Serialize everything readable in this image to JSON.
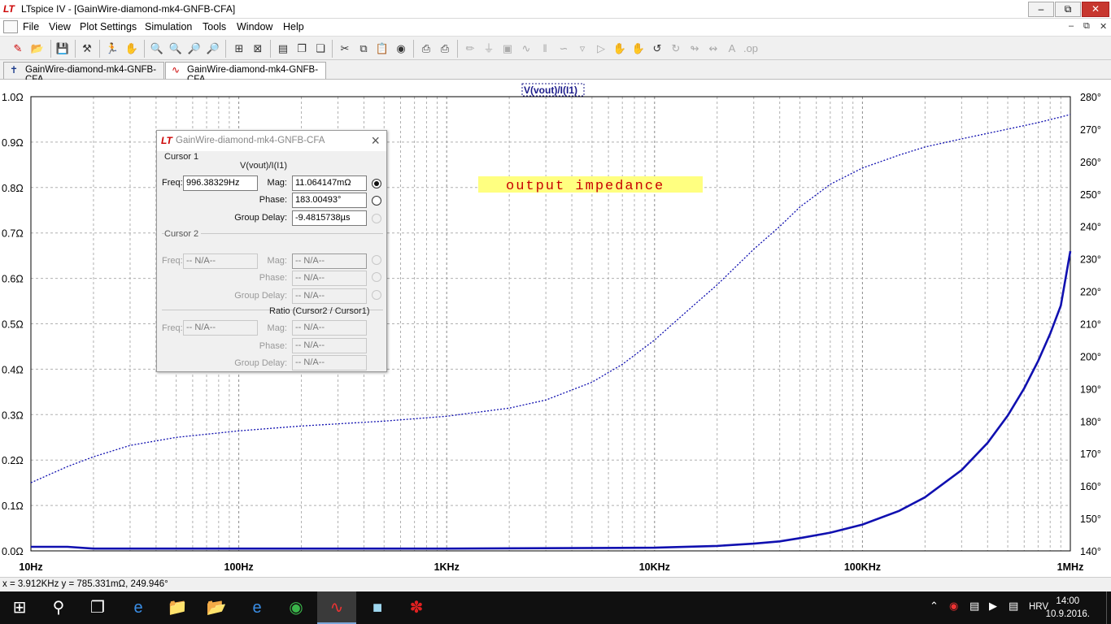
{
  "window": {
    "title": "LTspice IV - [GainWire-diamond-mk4-GNFB-CFA]"
  },
  "menu": {
    "items": [
      "File",
      "View",
      "Plot Settings",
      "Simulation",
      "Tools",
      "Window",
      "Help"
    ]
  },
  "tabs": [
    {
      "label": "GainWire-diamond-mk4-GNFB-CFA"
    },
    {
      "label": "GainWire-diamond-mk4-GNFB-CFA"
    }
  ],
  "plot": {
    "trace_label": "V(vout)/I(I1)",
    "annotation": "output impedance"
  },
  "chart_data": {
    "type": "line",
    "title": "V(vout)/I(I1)",
    "x_scale": "log",
    "xlim": [
      10,
      1000000
    ],
    "x_tick_labels": [
      {
        "value": 10,
        "label": "10Hz"
      },
      {
        "value": 100,
        "label": "100Hz"
      },
      {
        "value": 1000,
        "label": "1KHz"
      },
      {
        "value": 10000,
        "label": "10KHz"
      },
      {
        "value": 100000,
        "label": "100KHz"
      },
      {
        "value": 1000000,
        "label": "1MHz"
      }
    ],
    "ylim_left": [
      0,
      1.0
    ],
    "y_left_tick_labels": [
      "0.0Ω",
      "0.1Ω",
      "0.2Ω",
      "0.3Ω",
      "0.4Ω",
      "0.5Ω",
      "0.6Ω",
      "0.7Ω",
      "0.8Ω",
      "0.9Ω",
      "1.0Ω"
    ],
    "ylim_right": [
      140,
      280
    ],
    "y_right_tick_labels": [
      "140°",
      "150°",
      "160°",
      "170°",
      "180°",
      "190°",
      "200°",
      "210°",
      "220°",
      "230°",
      "240°",
      "250°",
      "260°",
      "270°",
      "280°"
    ],
    "grid": true,
    "series": [
      {
        "style": "solid",
        "axis": "left",
        "x": [
          10,
          15,
          20,
          100,
          1000,
          10000,
          20000,
          30000,
          40000,
          50000,
          70000,
          100000,
          150000,
          200000,
          300000,
          400000,
          500000,
          600000,
          700000,
          800000,
          900000,
          1000000
        ],
        "y": [
          0.009,
          0.009,
          0.005,
          0.005,
          0.005,
          0.007,
          0.011,
          0.016,
          0.021,
          0.028,
          0.04,
          0.058,
          0.088,
          0.118,
          0.178,
          0.238,
          0.298,
          0.358,
          0.418,
          0.478,
          0.54,
          0.66
        ]
      },
      {
        "style": "dotted",
        "axis": "right",
        "x": [
          10,
          15,
          20,
          30,
          50,
          100,
          200,
          500,
          1000,
          2000,
          3000,
          5000,
          7000,
          10000,
          15000,
          20000,
          30000,
          40000,
          50000,
          70000,
          100000,
          150000,
          200000,
          300000,
          500000,
          700000,
          1000000
        ],
        "y": [
          161,
          166,
          169,
          172.5,
          175,
          177,
          178.5,
          180,
          181.5,
          184,
          186.5,
          192,
          197.5,
          205,
          215,
          222,
          233,
          240,
          246,
          253,
          258,
          262,
          264.5,
          267,
          270,
          272,
          274.5
        ]
      }
    ]
  },
  "cursor_panel": {
    "title": "GainWire-diamond-mk4-GNFB-CFA",
    "cursor1": {
      "label": "Cursor 1",
      "expr": "V(vout)/I(I1)",
      "freq_label": "Freq:",
      "freq": "996.38329Hz",
      "mag_label": "Mag:",
      "mag": "11.064147mΩ",
      "phase_label": "Phase:",
      "phase": "183.00493°",
      "gd_label": "Group Delay:",
      "gd": "-9.4815738µs"
    },
    "cursor2": {
      "label": "Cursor 2",
      "freq_label": "Freq:",
      "freq": "-- N/A--",
      "mag_label": "Mag:",
      "mag": "-- N/A--",
      "phase_label": "Phase:",
      "phase": "-- N/A--",
      "gd_label": "Group Delay:",
      "gd": "-- N/A--"
    },
    "ratio": {
      "label": "Ratio (Cursor2 / Cursor1)",
      "freq_label": "Freq:",
      "freq": "-- N/A--",
      "mag_label": "Mag:",
      "mag": "-- N/A--",
      "phase_label": "Phase:",
      "phase": "-- N/A--",
      "gd_label": "Group Delay:",
      "gd": "-- N/A--"
    }
  },
  "status": {
    "text": "x = 3.912KHz   y = 785.331mΩ, 249.946°"
  },
  "taskbar": {
    "lang": "HRV",
    "time": "14:00",
    "date": "10.9.2016."
  }
}
